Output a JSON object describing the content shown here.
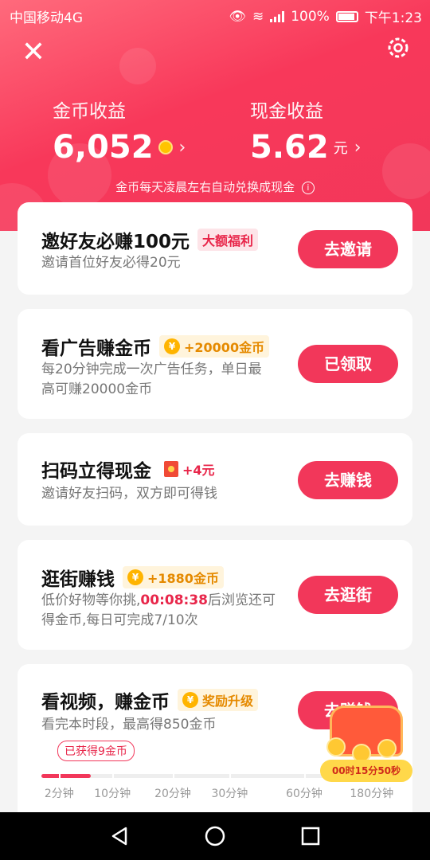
{
  "status_bar": {
    "carrier": "中国移动4G",
    "network": "4G",
    "battery": "100%",
    "time": "下午1:23"
  },
  "header": {
    "coin_label": "金币收益",
    "coin_value": "6,052",
    "cash_label": "现金收益",
    "cash_value": "5.62",
    "cash_unit": "元",
    "note": "金币每天凌晨左右自动兑换成现金"
  },
  "tasks": [
    {
      "title": "邀好友必赚100元",
      "tag": "大额福利",
      "desc": "邀请首位好友必得20元",
      "button": "去邀请"
    },
    {
      "title": "看广告赚金币",
      "tag": "+20000金币",
      "desc_line1": "每20分钟完成一次广告任务，单日最",
      "desc_line2": "高可赚20000金币",
      "button": "已领取"
    },
    {
      "title": "扫码立得现金",
      "tag": "+4元",
      "desc": "邀请好友扫码，双方即可得钱",
      "button": "去赚钱"
    },
    {
      "title": "逛街赚钱",
      "tag": "+1880金币",
      "desc_pre": "低价好物等你挑,",
      "desc_timer": "00:08:38",
      "desc_post": "后浏览还可",
      "desc_line2": "得金币,每日可完成7/10次",
      "button": "去逛街"
    },
    {
      "title": "看视频，赚金币",
      "tag": "奖励升级",
      "desc": "看完本时段，最高得850金币",
      "button": "去赚钱",
      "earned": "已获得9金币",
      "ticks": [
        "2分钟",
        "10分钟",
        "20分钟",
        "30分钟",
        "60分钟",
        "180分钟"
      ],
      "progress": 0.14
    }
  ],
  "chest": {
    "timer": "00时15分50秒"
  },
  "icons": {
    "coin_icon": "coin-icon",
    "yen_icon": "yen-icon",
    "envelope_icon": "red-envelope-icon"
  },
  "colors": {
    "accent": "#f2375a",
    "gold": "#ffb400"
  }
}
